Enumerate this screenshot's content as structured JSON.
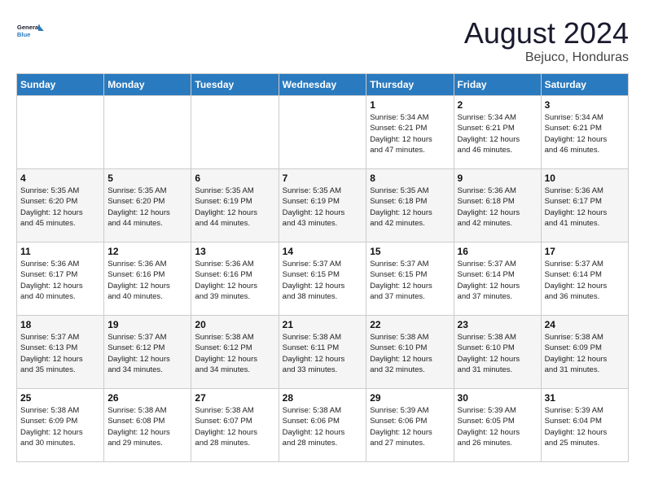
{
  "header": {
    "logo_line1": "General",
    "logo_line2": "Blue",
    "month": "August 2024",
    "location": "Bejuco, Honduras"
  },
  "days_of_week": [
    "Sunday",
    "Monday",
    "Tuesday",
    "Wednesday",
    "Thursday",
    "Friday",
    "Saturday"
  ],
  "weeks": [
    [
      {
        "day": "",
        "info": ""
      },
      {
        "day": "",
        "info": ""
      },
      {
        "day": "",
        "info": ""
      },
      {
        "day": "",
        "info": ""
      },
      {
        "day": "1",
        "info": "Sunrise: 5:34 AM\nSunset: 6:21 PM\nDaylight: 12 hours\nand 47 minutes."
      },
      {
        "day": "2",
        "info": "Sunrise: 5:34 AM\nSunset: 6:21 PM\nDaylight: 12 hours\nand 46 minutes."
      },
      {
        "day": "3",
        "info": "Sunrise: 5:34 AM\nSunset: 6:21 PM\nDaylight: 12 hours\nand 46 minutes."
      }
    ],
    [
      {
        "day": "4",
        "info": "Sunrise: 5:35 AM\nSunset: 6:20 PM\nDaylight: 12 hours\nand 45 minutes."
      },
      {
        "day": "5",
        "info": "Sunrise: 5:35 AM\nSunset: 6:20 PM\nDaylight: 12 hours\nand 44 minutes."
      },
      {
        "day": "6",
        "info": "Sunrise: 5:35 AM\nSunset: 6:19 PM\nDaylight: 12 hours\nand 44 minutes."
      },
      {
        "day": "7",
        "info": "Sunrise: 5:35 AM\nSunset: 6:19 PM\nDaylight: 12 hours\nand 43 minutes."
      },
      {
        "day": "8",
        "info": "Sunrise: 5:35 AM\nSunset: 6:18 PM\nDaylight: 12 hours\nand 42 minutes."
      },
      {
        "day": "9",
        "info": "Sunrise: 5:36 AM\nSunset: 6:18 PM\nDaylight: 12 hours\nand 42 minutes."
      },
      {
        "day": "10",
        "info": "Sunrise: 5:36 AM\nSunset: 6:17 PM\nDaylight: 12 hours\nand 41 minutes."
      }
    ],
    [
      {
        "day": "11",
        "info": "Sunrise: 5:36 AM\nSunset: 6:17 PM\nDaylight: 12 hours\nand 40 minutes."
      },
      {
        "day": "12",
        "info": "Sunrise: 5:36 AM\nSunset: 6:16 PM\nDaylight: 12 hours\nand 40 minutes."
      },
      {
        "day": "13",
        "info": "Sunrise: 5:36 AM\nSunset: 6:16 PM\nDaylight: 12 hours\nand 39 minutes."
      },
      {
        "day": "14",
        "info": "Sunrise: 5:37 AM\nSunset: 6:15 PM\nDaylight: 12 hours\nand 38 minutes."
      },
      {
        "day": "15",
        "info": "Sunrise: 5:37 AM\nSunset: 6:15 PM\nDaylight: 12 hours\nand 37 minutes."
      },
      {
        "day": "16",
        "info": "Sunrise: 5:37 AM\nSunset: 6:14 PM\nDaylight: 12 hours\nand 37 minutes."
      },
      {
        "day": "17",
        "info": "Sunrise: 5:37 AM\nSunset: 6:14 PM\nDaylight: 12 hours\nand 36 minutes."
      }
    ],
    [
      {
        "day": "18",
        "info": "Sunrise: 5:37 AM\nSunset: 6:13 PM\nDaylight: 12 hours\nand 35 minutes."
      },
      {
        "day": "19",
        "info": "Sunrise: 5:37 AM\nSunset: 6:12 PM\nDaylight: 12 hours\nand 34 minutes."
      },
      {
        "day": "20",
        "info": "Sunrise: 5:38 AM\nSunset: 6:12 PM\nDaylight: 12 hours\nand 34 minutes."
      },
      {
        "day": "21",
        "info": "Sunrise: 5:38 AM\nSunset: 6:11 PM\nDaylight: 12 hours\nand 33 minutes."
      },
      {
        "day": "22",
        "info": "Sunrise: 5:38 AM\nSunset: 6:10 PM\nDaylight: 12 hours\nand 32 minutes."
      },
      {
        "day": "23",
        "info": "Sunrise: 5:38 AM\nSunset: 6:10 PM\nDaylight: 12 hours\nand 31 minutes."
      },
      {
        "day": "24",
        "info": "Sunrise: 5:38 AM\nSunset: 6:09 PM\nDaylight: 12 hours\nand 31 minutes."
      }
    ],
    [
      {
        "day": "25",
        "info": "Sunrise: 5:38 AM\nSunset: 6:09 PM\nDaylight: 12 hours\nand 30 minutes."
      },
      {
        "day": "26",
        "info": "Sunrise: 5:38 AM\nSunset: 6:08 PM\nDaylight: 12 hours\nand 29 minutes."
      },
      {
        "day": "27",
        "info": "Sunrise: 5:38 AM\nSunset: 6:07 PM\nDaylight: 12 hours\nand 28 minutes."
      },
      {
        "day": "28",
        "info": "Sunrise: 5:38 AM\nSunset: 6:06 PM\nDaylight: 12 hours\nand 28 minutes."
      },
      {
        "day": "29",
        "info": "Sunrise: 5:39 AM\nSunset: 6:06 PM\nDaylight: 12 hours\nand 27 minutes."
      },
      {
        "day": "30",
        "info": "Sunrise: 5:39 AM\nSunset: 6:05 PM\nDaylight: 12 hours\nand 26 minutes."
      },
      {
        "day": "31",
        "info": "Sunrise: 5:39 AM\nSunset: 6:04 PM\nDaylight: 12 hours\nand 25 minutes."
      }
    ]
  ]
}
